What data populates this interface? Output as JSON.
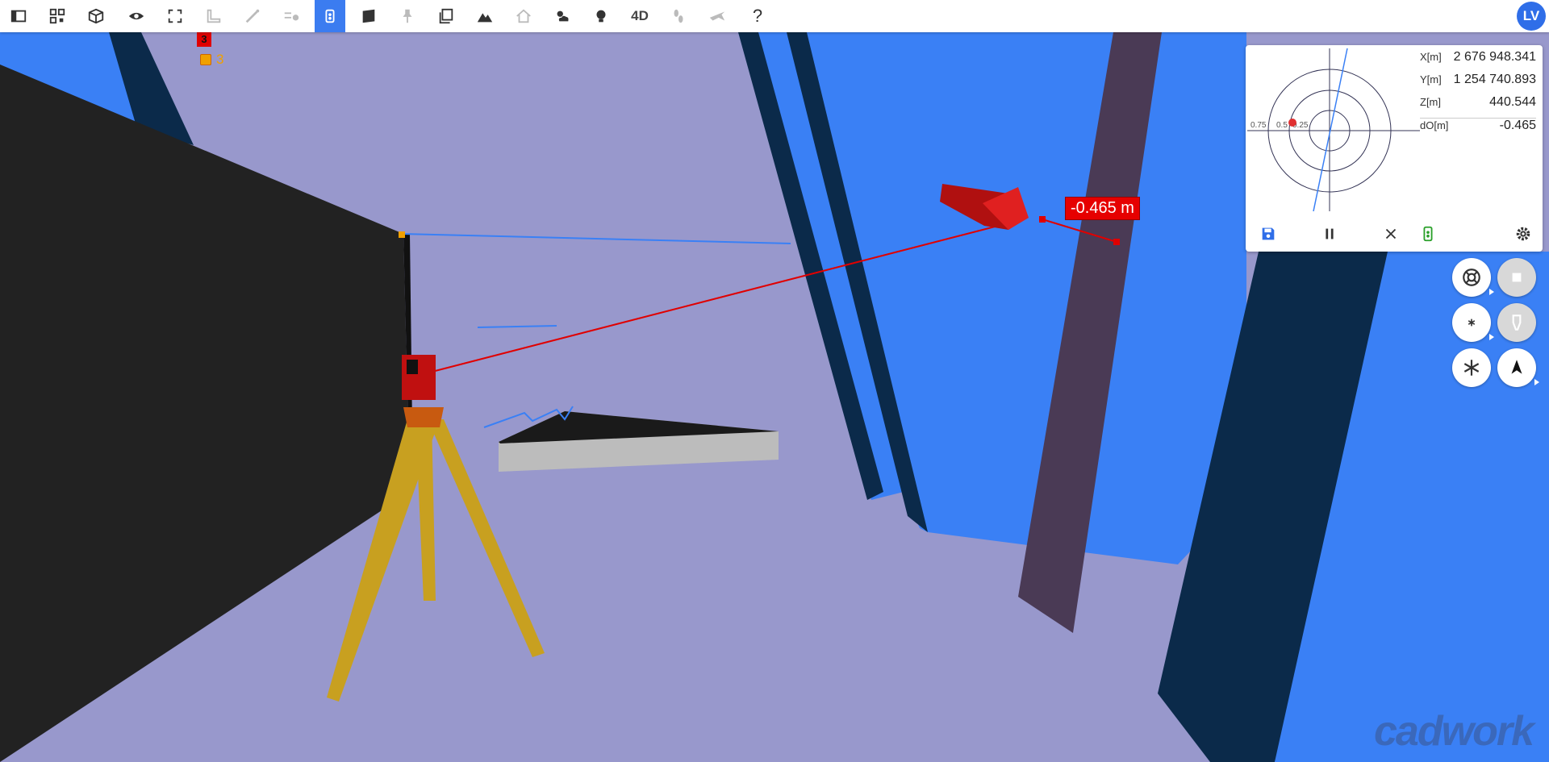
{
  "toolbar": {
    "items": [
      {
        "name": "sidebar-toggle-icon",
        "active": false
      },
      {
        "name": "qr-code-icon",
        "active": false
      },
      {
        "name": "cube-view-icon",
        "active": false
      },
      {
        "name": "eye-icon",
        "active": false
      },
      {
        "name": "fullscreen-icon",
        "active": false
      },
      {
        "name": "ruler-icon",
        "active": false
      },
      {
        "name": "wand-icon",
        "active": false
      },
      {
        "name": "location-list-icon",
        "active": false
      },
      {
        "name": "total-station-icon",
        "active": true
      },
      {
        "name": "map-layers-icon",
        "active": false
      },
      {
        "name": "pin-icon",
        "active": false
      },
      {
        "name": "copy-icon",
        "active": false
      },
      {
        "name": "terrain-icon",
        "active": false
      },
      {
        "name": "house-icon",
        "active": false
      },
      {
        "name": "weather-icon",
        "active": false
      },
      {
        "name": "bulb-icon",
        "active": false
      },
      {
        "name": "4d-label",
        "active": false
      },
      {
        "name": "walk-icon",
        "active": false
      },
      {
        "name": "plane-icon",
        "active": false
      },
      {
        "name": "help-icon",
        "active": false
      }
    ],
    "label_4d": "4D",
    "help_label": "?",
    "avatar_initials": "LV",
    "accent": "#3b7cf0"
  },
  "scene": {
    "badge_red": "3",
    "badge_orange": "3",
    "measure_label": "-0.465 m"
  },
  "panel": {
    "rings": [
      "0.75",
      "0.5",
      "0.25"
    ],
    "coords": [
      {
        "key": "X[m]",
        "value": "2 676 948.341"
      },
      {
        "key": "Y[m]",
        "value": "1 254 740.893"
      },
      {
        "key": "Z[m]",
        "value": "440.544"
      },
      {
        "key": "dO[m]",
        "value": "-0.465"
      }
    ]
  },
  "side_buttons": [
    {
      "name": "lifebuoy-button",
      "enabled": true
    },
    {
      "name": "stop-button",
      "enabled": false
    },
    {
      "name": "asterisk-small-button",
      "enabled": true
    },
    {
      "name": "prism-button",
      "enabled": false
    },
    {
      "name": "asterisk-large-button",
      "enabled": true
    },
    {
      "name": "north-arrow-button",
      "enabled": true
    }
  ],
  "logo_text": "cadwork"
}
